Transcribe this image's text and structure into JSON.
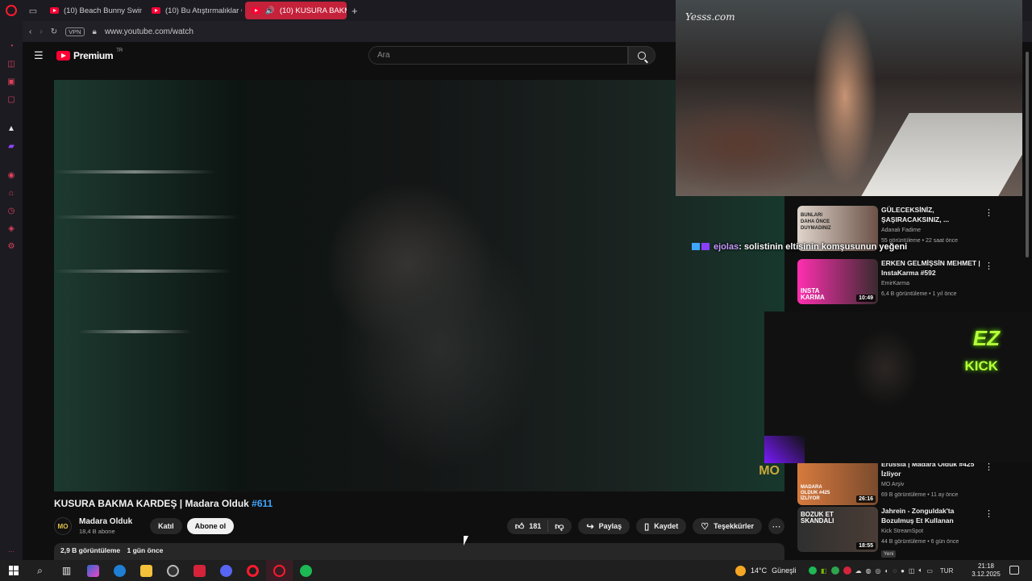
{
  "browser": {
    "tabs": [
      {
        "label": "(10) Beach Bunny Swimw",
        "active": false
      },
      {
        "label": "(10) Bu Atıştırmalıklar Gen",
        "active": false
      },
      {
        "label": "(10) KUSURA BAKMA",
        "active": true
      }
    ],
    "new_tab": "+",
    "vpn": "VPN",
    "url": "www.youtube.com/watch"
  },
  "youtube": {
    "logo_text": "Premium",
    "logo_region": "TR",
    "search_placeholder": "Ara",
    "video": {
      "title": "KUSURA BAKMA KARDEŞ | Madara Olduk",
      "tag": "#611",
      "watermark": "MO",
      "channel_avatar": "MO",
      "channel_name": "Madara Olduk",
      "subscribers": "18,4 B abone",
      "join_label": "Katıl",
      "subscribe_label": "Abone ol",
      "likes": "181",
      "share_label": "Paylaş",
      "save_label": "Kaydet",
      "thanks_label": "Teşekkürler",
      "views": "2,9 B görüntüleme",
      "published": "1 gün önce"
    },
    "recommendations": [
      {
        "title": "GÜLECEKSİNİZ, ŞAŞIRACAKSINIZ, ...",
        "channel": "Adanalı Fadime",
        "meta": "55 görüntüleme • 22 saat önce",
        "thumb_text": "BUNLARI DAHA ÖNCE DUYMADINIZ",
        "duration": "",
        "badge": ""
      },
      {
        "title": "ERKEN GELMİŞSİN MEHMET | InstaKarma #592",
        "channel": "EmirKarma",
        "meta": "6,4 B görüntüleme • 1 yıl önce",
        "thumb_text": "INSTA KARMA",
        "duration": "10:49",
        "badge": ""
      },
      {
        "title": "Erussia | Madara Olduk #425 İzliyor",
        "channel": "MO Arşiv",
        "meta": "69 B görüntüleme • 11 ay önce",
        "thumb_text": "MADARA OLDUK #425 İZLİYOR",
        "duration": "26:16",
        "badge": ""
      },
      {
        "title": "Jahrein - Zonguldak'ta Bozulmuş Et Kullanan Pideciyi...",
        "channel": "Kick StreamSpot",
        "meta": "44 B görüntüleme • 6 gün önce",
        "thumb_text": "BOZUK ET SKANDALI",
        "duration": "18:55",
        "badge": "Yeni"
      }
    ]
  },
  "overlay": {
    "watermark": "Yesss.com",
    "chat_user": "ejolas",
    "chat_message": ": solistinin eltisinin komşusunun yeğeni",
    "cam_text_1": "EZ",
    "cam_text_2": "KICK"
  },
  "taskbar": {
    "temperature": "14°C",
    "weather": "Güneşli",
    "language": "TUR",
    "time": "21:18",
    "date": "3.12.2025"
  },
  "colors": {
    "youtube_red": "#ff0033",
    "opera_red": "#ff1b2d",
    "active_tab": "#c4213a",
    "link_blue": "#3ea6ff",
    "kick_green": "#b9ff3a"
  }
}
